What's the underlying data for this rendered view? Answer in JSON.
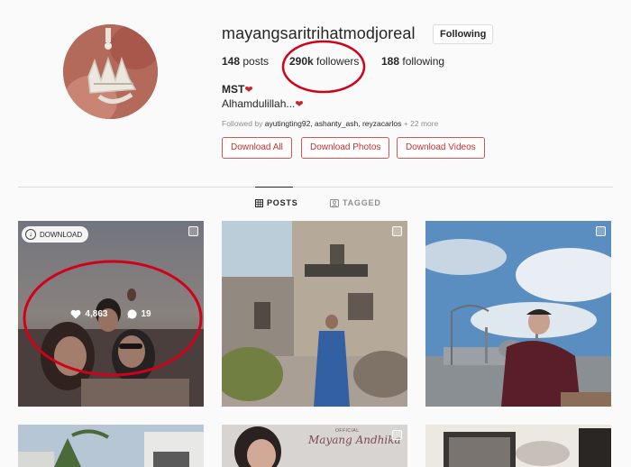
{
  "profile": {
    "username": "mayangsaritrihatmodjoreal",
    "follow_button": "Following",
    "stats": {
      "posts_count": "148",
      "posts_label": "posts",
      "followers_count": "290k",
      "followers_label": "followers",
      "following_count": "188",
      "following_label": "following"
    },
    "full_name": "MST",
    "bio": "Alhamdulillah...",
    "followed_by_prefix": "Followed by",
    "followed_by_users": "ayutingting92, ashanty_ash, reyzacarlos",
    "followed_by_more": "+ 22 more"
  },
  "download_buttons": {
    "all": "Download All",
    "photos": "Download Photos",
    "videos": "Download Videos"
  },
  "tabs": {
    "posts": "POSTS",
    "tagged": "TAGGED"
  },
  "posts": {
    "first": {
      "download_badge": "DOWNLOAD",
      "likes": "4,863",
      "comments": "19"
    },
    "watermark": "OFFICIAL",
    "signature": "Mayang Andhika"
  },
  "colors": {
    "annotation_red": "#d0021b",
    "download_red": "#c9302c"
  }
}
